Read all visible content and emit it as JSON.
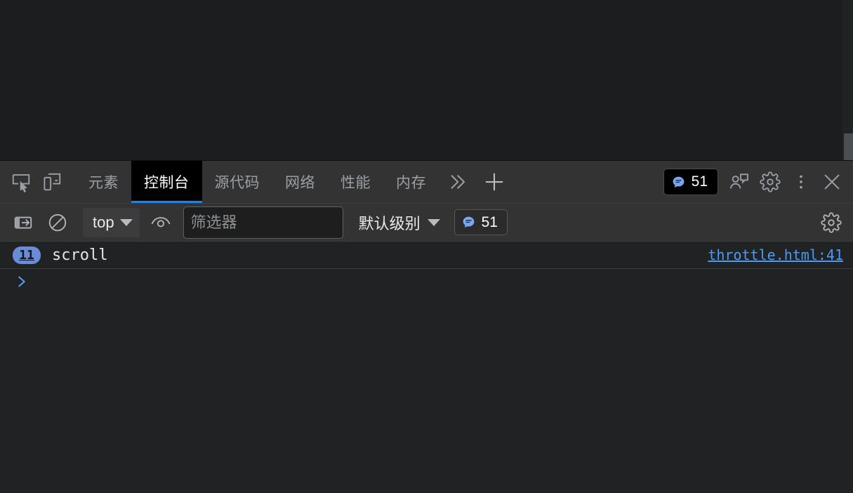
{
  "viewport": {
    "scrollbar": {
      "name": "page-scrollbar"
    }
  },
  "devtools": {
    "tabbar": {
      "inspect_icon": "inspect-element-icon",
      "device_icon": "device-toolbar-icon",
      "tabs": [
        {
          "label": "元素",
          "active": false
        },
        {
          "label": "控制台",
          "active": true
        },
        {
          "label": "源代码",
          "active": false
        },
        {
          "label": "网络",
          "active": false
        },
        {
          "label": "性能",
          "active": false
        },
        {
          "label": "内存",
          "active": false
        }
      ],
      "more_tabs_icon": "chevron-double-right-icon",
      "add_tab_icon": "plus-icon",
      "message_count": "51",
      "message_icon": "speech-bubble-icon",
      "inspect_issues_icon": "issues-icon",
      "settings_icon": "gear-icon",
      "more_options_icon": "kebab-menu-icon",
      "close_icon": "close-icon"
    },
    "toolbar": {
      "sidebar_toggle_icon": "console-sidebar-toggle-icon",
      "clear_console_icon": "clear-console-icon",
      "context": {
        "label": "top",
        "caret_icon": "chevron-down-icon"
      },
      "live_expression_icon": "eye-icon",
      "filter": {
        "placeholder": "筛选器",
        "value": ""
      },
      "level": {
        "label": "默认级别",
        "caret_icon": "chevron-down-icon"
      },
      "message_count": "51",
      "message_icon": "speech-bubble-icon",
      "settings_icon": "gear-icon"
    },
    "console": {
      "messages": [
        {
          "repeat_count": "11",
          "text": "scroll",
          "source": "throttle.html:41"
        }
      ],
      "prompt_caret": ">"
    }
  },
  "colors": {
    "accent_blue": "#0b87f7",
    "link_blue": "#4a9bf5",
    "badge_blue": "#6a8cd6",
    "panel_bg": "#333333",
    "console_bg": "#212224",
    "page_bg": "#1b1d1e"
  }
}
